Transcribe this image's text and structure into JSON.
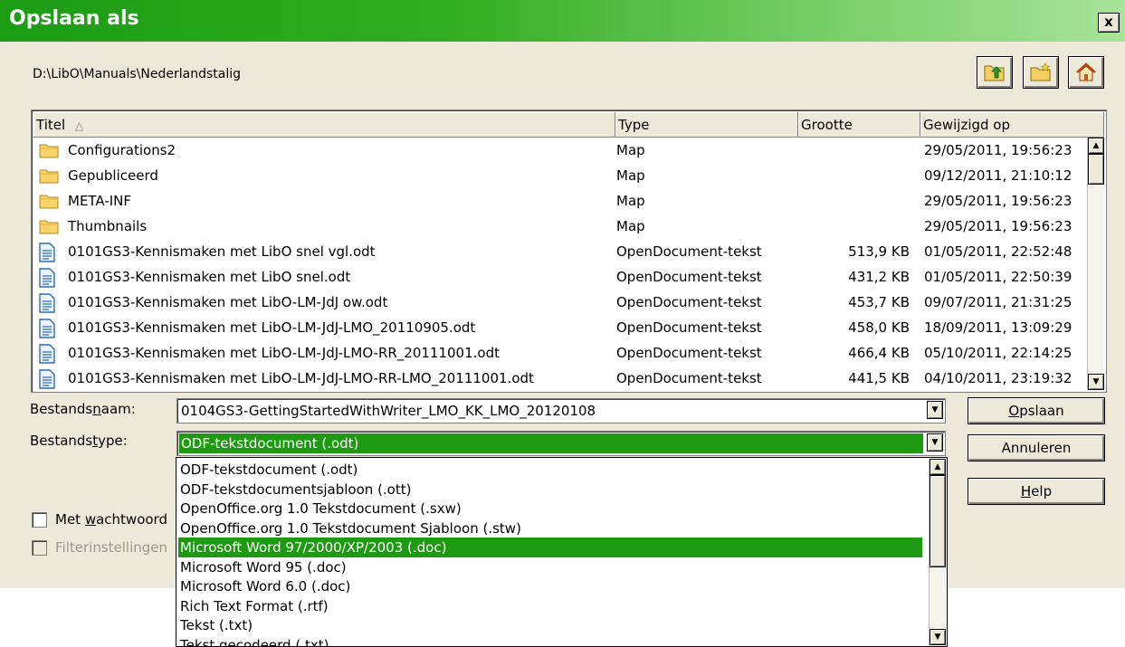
{
  "window": {
    "title": "Opslaan als",
    "close_glyph": "x"
  },
  "path": "D:\\LibO\\Manuals\\Nederlandstalig",
  "toolbar": {
    "buttons": [
      {
        "name": "up-folder-icon"
      },
      {
        "name": "new-folder-icon"
      },
      {
        "name": "home-icon"
      }
    ]
  },
  "columns": {
    "title": "Titel",
    "type": "Type",
    "size": "Grootte",
    "modified": "Gewijzigd op"
  },
  "files": [
    {
      "name": "Configurations2",
      "type": "Map",
      "size": "",
      "modified": "29/05/2011, 19:56:23",
      "icon": "folder-icon"
    },
    {
      "name": "Gepubliceerd",
      "type": "Map",
      "size": "",
      "modified": "09/12/2011, 21:10:12",
      "icon": "folder-icon"
    },
    {
      "name": "META-INF",
      "type": "Map",
      "size": "",
      "modified": "29/05/2011, 19:56:23",
      "icon": "folder-icon"
    },
    {
      "name": "Thumbnails",
      "type": "Map",
      "size": "",
      "modified": "29/05/2011, 19:56:23",
      "icon": "folder-icon"
    },
    {
      "name": "0101GS3-Kennismaken met LibO snel vgl.odt",
      "type": "OpenDocument-tekst",
      "size": "513,9 KB",
      "modified": "01/05/2011, 22:52:48",
      "icon": "document-icon"
    },
    {
      "name": "0101GS3-Kennismaken met LibO snel.odt",
      "type": "OpenDocument-tekst",
      "size": "431,2 KB",
      "modified": "01/05/2011, 22:50:39",
      "icon": "document-icon"
    },
    {
      "name": "0101GS3-Kennismaken met LibO-LM-JdJ ow.odt",
      "type": "OpenDocument-tekst",
      "size": "453,7 KB",
      "modified": "09/07/2011, 21:31:25",
      "icon": "document-icon"
    },
    {
      "name": "0101GS3-Kennismaken met LibO-LM-JdJ-LMO_20110905.odt",
      "type": "OpenDocument-tekst",
      "size": "458,0 KB",
      "modified": "18/09/2011, 13:09:29",
      "icon": "document-icon"
    },
    {
      "name": "0101GS3-Kennismaken met LibO-LM-JdJ-LMO-RR_20111001.odt",
      "type": "OpenDocument-tekst",
      "size": "466,4 KB",
      "modified": "05/10/2011, 22:14:25",
      "icon": "document-icon"
    },
    {
      "name": "0101GS3-Kennismaken met LibO-LM-JdJ-LMO-RR-LMO_20111001.odt",
      "type": "OpenDocument-tekst",
      "size": "441,5 KB",
      "modified": "04/10/2011, 23:19:32",
      "icon": "document-icon"
    }
  ],
  "filename": {
    "label_pre": "Bestands",
    "label_ul": "n",
    "label_post": "aam:",
    "value": "0104GS3-GettingStartedWithWriter_LMO_KK_LMO_20120108"
  },
  "filetype": {
    "label_pre": "Bestands",
    "label_ul": "t",
    "label_post": "ype:",
    "value": "ODF-tekstdocument (.odt)"
  },
  "buttons": {
    "save": {
      "ul": "O",
      "rest": "pslaan"
    },
    "cancel": "Annuleren",
    "help": {
      "ul": "H",
      "rest": "elp"
    }
  },
  "options": {
    "password": {
      "pre": "Met ",
      "ul": "w",
      "post": "achtwoord"
    },
    "filter": "Filterinstellingen"
  },
  "filetype_options": [
    "ODF-tekstdocument (.odt)",
    "ODF-tekstdocumentsjabloon (.ott)",
    "OpenOffice.org 1.0 Tekstdocument (.sxw)",
    "OpenOffice.org 1.0 Tekstdocument Sjabloon (.stw)",
    "Microsoft Word 97/2000/XP/2003 (.doc)",
    "Microsoft Word 95 (.doc)",
    "Microsoft Word 6.0 (.doc)",
    "Rich Text Format (.rtf)",
    "Tekst (.txt)",
    "Tekst gecodeerd (.txt)"
  ],
  "selected_option_index": 4,
  "colors": {
    "accent": "#1e9a12",
    "dialog_bg": "#ece9d8"
  }
}
